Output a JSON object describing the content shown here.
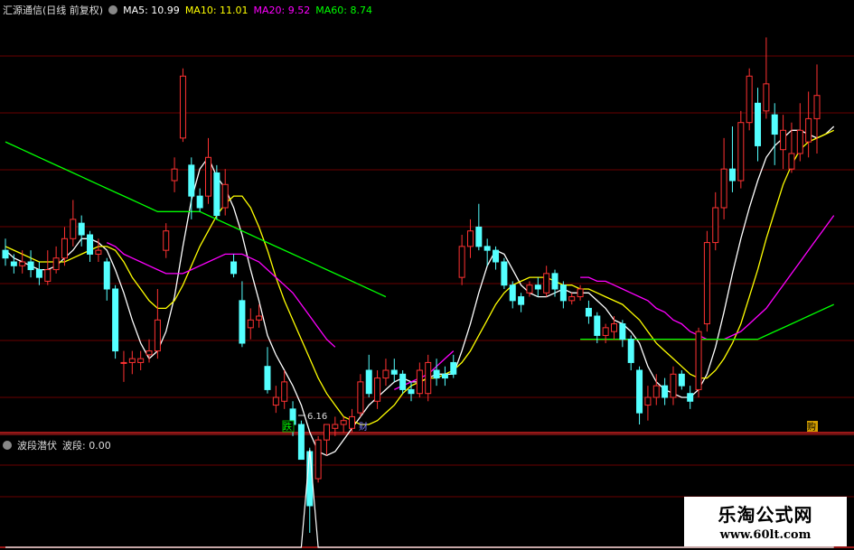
{
  "header": {
    "title": "汇源通信(日线 前复权)",
    "ma5": "MA5: 10.99",
    "ma10": "MA10: 11.01",
    "ma20": "MA20: 9.52",
    "ma60": "MA60: 8.74"
  },
  "sub_header": {
    "name": "波段潜伏",
    "value": "波段: 0.00"
  },
  "low_label": "6.16",
  "signal_labels": {
    "a": "跌",
    "b": "财",
    "c": "购"
  },
  "watermark": {
    "cn": "乐淘公式网",
    "url": "www.60lt.com"
  },
  "colors": {
    "up": "#ff3232",
    "down": "#54ffff",
    "ma5": "#ffffff",
    "ma10": "#ffff00",
    "ma20": "#ff00ff",
    "ma60": "#00ff00",
    "grid": "#8b0000",
    "bg": "#000000"
  },
  "chart_data": [
    {
      "type": "candlestick",
      "title": "汇源通信(日线 前复权)",
      "ylim": [
        5.0,
        15.5
      ],
      "candles": [
        {
          "o": 9.5,
          "c": 9.3,
          "h": 9.8,
          "l": 9.1
        },
        {
          "o": 9.2,
          "c": 9.1,
          "h": 9.4,
          "l": 8.9
        },
        {
          "o": 9.1,
          "c": 9.2,
          "h": 9.5,
          "l": 8.9
        },
        {
          "o": 9.2,
          "c": 9.0,
          "h": 9.5,
          "l": 8.8
        },
        {
          "o": 9.0,
          "c": 8.8,
          "h": 9.2,
          "l": 8.6
        },
        {
          "o": 8.7,
          "c": 9.0,
          "h": 9.5,
          "l": 8.6
        },
        {
          "o": 9.0,
          "c": 9.3,
          "h": 9.6,
          "l": 8.9
        },
        {
          "o": 9.3,
          "c": 9.8,
          "h": 10.1,
          "l": 9.1
        },
        {
          "o": 9.8,
          "c": 10.3,
          "h": 10.8,
          "l": 9.6
        },
        {
          "o": 10.2,
          "c": 9.9,
          "h": 10.4,
          "l": 9.6
        },
        {
          "o": 9.9,
          "c": 9.4,
          "h": 10.0,
          "l": 9.2
        },
        {
          "o": 9.4,
          "c": 9.5,
          "h": 9.8,
          "l": 9.2
        },
        {
          "o": 9.2,
          "c": 8.5,
          "h": 9.3,
          "l": 8.2
        },
        {
          "o": 8.5,
          "c": 6.9,
          "h": 8.6,
          "l": 6.7
        },
        {
          "o": 6.6,
          "c": 6.6,
          "h": 6.9,
          "l": 6.1
        },
        {
          "o": 6.6,
          "c": 6.7,
          "h": 6.9,
          "l": 6.3
        },
        {
          "o": 6.6,
          "c": 6.7,
          "h": 6.9,
          "l": 6.4
        },
        {
          "o": 6.8,
          "c": 6.9,
          "h": 7.2,
          "l": 6.6
        },
        {
          "o": 6.9,
          "c": 7.7,
          "h": 8.5,
          "l": 6.7
        },
        {
          "o": 9.5,
          "c": 10.0,
          "h": 10.2,
          "l": 9.3
        },
        {
          "o": 11.3,
          "c": 11.6,
          "h": 11.9,
          "l": 11.0
        },
        {
          "o": 12.4,
          "c": 14.0,
          "h": 14.2,
          "l": 12.3
        },
        {
          "o": 11.7,
          "c": 10.9,
          "h": 11.9,
          "l": 10.3
        },
        {
          "o": 10.9,
          "c": 10.6,
          "h": 11.1,
          "l": 10.5
        },
        {
          "o": 10.9,
          "c": 11.9,
          "h": 12.4,
          "l": 10.7
        },
        {
          "o": 11.5,
          "c": 10.4,
          "h": 11.7,
          "l": 10.3
        },
        {
          "o": 10.6,
          "c": 11.2,
          "h": 11.6,
          "l": 10.4
        },
        {
          "o": 9.2,
          "c": 8.9,
          "h": 9.4,
          "l": 8.8
        },
        {
          "o": 8.2,
          "c": 7.1,
          "h": 8.7,
          "l": 7.0
        },
        {
          "o": 7.5,
          "c": 7.7,
          "h": 8.0,
          "l": 7.2
        },
        {
          "o": 7.7,
          "c": 7.8,
          "h": 8.1,
          "l": 7.5
        },
        {
          "o": 6.5,
          "c": 5.9,
          "h": 7.0,
          "l": 5.8
        },
        {
          "o": 5.5,
          "c": 5.7,
          "h": 6.0,
          "l": 5.3
        },
        {
          "o": 5.6,
          "c": 6.1,
          "h": 6.4,
          "l": 5.4
        },
        {
          "o": 5.4,
          "c": 5.0,
          "h": 5.6,
          "l": 4.7
        },
        {
          "o": 5.0,
          "c": 4.1,
          "h": 5.1,
          "l": 4.1
        },
        {
          "o": 4.3,
          "c": 2.9,
          "h": 4.4,
          "l": 2.2
        },
        {
          "o": 3.6,
          "c": 4.6,
          "h": 4.7,
          "l": 3.5
        },
        {
          "o": 4.6,
          "c": 5.0,
          "h": 5.0,
          "l": 4.2
        },
        {
          "o": 4.9,
          "c": 5.0,
          "h": 5.2,
          "l": 4.7
        },
        {
          "o": 5.0,
          "c": 5.1,
          "h": 5.2,
          "l": 4.8
        },
        {
          "o": 4.9,
          "c": 5.2,
          "h": 5.4,
          "l": 4.8
        },
        {
          "o": 5.3,
          "c": 6.1,
          "h": 6.3,
          "l": 5.2
        },
        {
          "o": 6.4,
          "c": 5.8,
          "h": 6.8,
          "l": 5.7
        },
        {
          "o": 5.6,
          "c": 6.2,
          "h": 6.4,
          "l": 5.4
        },
        {
          "o": 6.2,
          "c": 6.4,
          "h": 6.7,
          "l": 6.0
        },
        {
          "o": 6.4,
          "c": 6.3,
          "h": 6.7,
          "l": 6.1
        },
        {
          "o": 6.3,
          "c": 5.9,
          "h": 6.4,
          "l": 5.8
        },
        {
          "o": 5.9,
          "c": 5.8,
          "h": 6.1,
          "l": 5.6
        },
        {
          "o": 5.8,
          "c": 6.4,
          "h": 6.6,
          "l": 5.7
        },
        {
          "o": 5.8,
          "c": 6.6,
          "h": 6.8,
          "l": 5.6
        },
        {
          "o": 6.4,
          "c": 6.2,
          "h": 6.7,
          "l": 6.0
        },
        {
          "o": 6.3,
          "c": 6.2,
          "h": 6.5,
          "l": 6.0
        },
        {
          "o": 6.6,
          "c": 6.3,
          "h": 6.8,
          "l": 6.2
        },
        {
          "o": 8.8,
          "c": 9.6,
          "h": 9.9,
          "l": 8.6
        },
        {
          "o": 9.6,
          "c": 10.0,
          "h": 10.3,
          "l": 9.3
        },
        {
          "o": 10.1,
          "c": 9.6,
          "h": 10.7,
          "l": 9.5
        },
        {
          "o": 9.6,
          "c": 9.5,
          "h": 9.8,
          "l": 9.1
        },
        {
          "o": 9.5,
          "c": 9.2,
          "h": 9.6,
          "l": 9.0
        },
        {
          "o": 9.2,
          "c": 8.6,
          "h": 9.3,
          "l": 8.5
        },
        {
          "o": 8.6,
          "c": 8.2,
          "h": 8.7,
          "l": 8.0
        },
        {
          "o": 8.3,
          "c": 8.1,
          "h": 8.4,
          "l": 7.9
        },
        {
          "o": 8.4,
          "c": 8.6,
          "h": 8.7,
          "l": 8.3
        },
        {
          "o": 8.6,
          "c": 8.5,
          "h": 8.8,
          "l": 8.3
        },
        {
          "o": 8.4,
          "c": 8.9,
          "h": 9.1,
          "l": 8.3
        },
        {
          "o": 8.9,
          "c": 8.5,
          "h": 9.0,
          "l": 8.3
        },
        {
          "o": 8.6,
          "c": 8.2,
          "h": 8.7,
          "l": 8.0
        },
        {
          "o": 8.2,
          "c": 8.3,
          "h": 8.4,
          "l": 8.1
        },
        {
          "o": 8.3,
          "c": 8.5,
          "h": 8.6,
          "l": 8.2
        },
        {
          "o": 8.0,
          "c": 7.8,
          "h": 8.2,
          "l": 7.6
        },
        {
          "o": 7.8,
          "c": 7.3,
          "h": 7.9,
          "l": 7.1
        },
        {
          "o": 7.3,
          "c": 7.5,
          "h": 7.6,
          "l": 7.1
        },
        {
          "o": 7.4,
          "c": 7.6,
          "h": 7.8,
          "l": 7.2
        },
        {
          "o": 7.6,
          "c": 7.2,
          "h": 7.7,
          "l": 7.0
        },
        {
          "o": 7.2,
          "c": 6.6,
          "h": 7.3,
          "l": 6.4
        },
        {
          "o": 6.4,
          "c": 5.3,
          "h": 6.5,
          "l": 5.0
        },
        {
          "o": 5.5,
          "c": 5.7,
          "h": 6.0,
          "l": 5.1
        },
        {
          "o": 5.7,
          "c": 6.0,
          "h": 6.3,
          "l": 5.5
        },
        {
          "o": 6.0,
          "c": 5.7,
          "h": 6.2,
          "l": 5.5
        },
        {
          "o": 5.7,
          "c": 6.3,
          "h": 6.5,
          "l": 5.5
        },
        {
          "o": 6.3,
          "c": 6.0,
          "h": 6.4,
          "l": 5.9
        },
        {
          "o": 5.8,
          "c": 5.6,
          "h": 6.0,
          "l": 5.4
        },
        {
          "o": 5.9,
          "c": 7.4,
          "h": 7.5,
          "l": 5.7
        },
        {
          "o": 7.6,
          "c": 9.7,
          "h": 10.0,
          "l": 7.4
        },
        {
          "o": 9.7,
          "c": 10.6,
          "h": 11.0,
          "l": 9.5
        },
        {
          "o": 10.6,
          "c": 11.6,
          "h": 12.4,
          "l": 10.3
        },
        {
          "o": 11.6,
          "c": 11.3,
          "h": 12.7,
          "l": 11.0
        },
        {
          "o": 11.3,
          "c": 12.8,
          "h": 13.1,
          "l": 11.1
        },
        {
          "o": 12.8,
          "c": 14.0,
          "h": 14.2,
          "l": 12.6
        },
        {
          "o": 13.3,
          "c": 12.2,
          "h": 13.7,
          "l": 11.8
        },
        {
          "o": 13.1,
          "c": 13.8,
          "h": 15.0,
          "l": 12.9
        },
        {
          "o": 13.0,
          "c": 12.5,
          "h": 13.3,
          "l": 11.7
        },
        {
          "o": 12.1,
          "c": 12.6,
          "h": 13.0,
          "l": 11.6
        },
        {
          "o": 11.6,
          "c": 12.0,
          "h": 12.8,
          "l": 11.5
        },
        {
          "o": 12.0,
          "c": 12.6,
          "h": 13.3,
          "l": 11.8
        },
        {
          "o": 12.3,
          "c": 12.9,
          "h": 13.6,
          "l": 11.9
        },
        {
          "o": 12.9,
          "c": 13.5,
          "h": 14.3,
          "l": 12.0
        }
      ],
      "ma": [
        {
          "name": "MA5",
          "values": [
            9.5,
            9.3,
            9.2,
            9.1,
            9.0,
            9.0,
            9.1,
            9.3,
            9.5,
            9.8,
            9.8,
            9.7,
            9.5,
            9.0,
            8.4,
            7.7,
            7.1,
            6.7,
            6.9,
            7.4,
            8.3,
            9.6,
            10.8,
            11.6,
            11.9,
            11.4,
            11.1,
            10.6,
            9.9,
            9.0,
            8.2,
            7.3,
            6.8,
            6.4,
            6.0,
            5.5,
            4.8,
            4.3,
            4.2,
            4.3,
            4.6,
            4.9,
            5.2,
            5.5,
            5.7,
            5.9,
            6.1,
            6.2,
            6.1,
            6.1,
            6.2,
            6.3,
            6.3,
            6.3,
            6.9,
            7.6,
            8.4,
            9.1,
            9.5,
            9.4,
            9.0,
            8.6,
            8.4,
            8.3,
            8.3,
            8.4,
            8.5,
            8.4,
            8.4,
            8.4,
            8.2,
            8.0,
            7.7,
            7.6,
            7.4,
            7.1,
            6.5,
            6.1,
            5.9,
            5.8,
            5.7,
            5.7,
            5.9,
            6.3,
            7.0,
            7.9,
            8.9,
            9.8,
            10.6,
            11.3,
            11.9,
            12.2,
            12.4,
            12.6,
            12.6,
            12.5,
            12.4,
            12.5,
            12.7
          ]
        },
        {
          "name": "MA10",
          "values": [
            9.6,
            9.5,
            9.4,
            9.3,
            9.2,
            9.2,
            9.2,
            9.2,
            9.3,
            9.4,
            9.5,
            9.6,
            9.6,
            9.5,
            9.2,
            8.8,
            8.5,
            8.2,
            8.0,
            8.0,
            8.2,
            8.6,
            9.1,
            9.6,
            10.0,
            10.4,
            10.7,
            10.9,
            10.9,
            10.6,
            10.1,
            9.5,
            8.8,
            8.2,
            7.7,
            7.2,
            6.7,
            6.2,
            5.8,
            5.5,
            5.2,
            5.1,
            5.0,
            5.0,
            5.1,
            5.3,
            5.5,
            5.8,
            6.0,
            6.1,
            6.2,
            6.2,
            6.3,
            6.4,
            6.6,
            6.9,
            7.3,
            7.7,
            8.1,
            8.4,
            8.6,
            8.7,
            8.8,
            8.8,
            8.8,
            8.7,
            8.6,
            8.6,
            8.5,
            8.5,
            8.4,
            8.3,
            8.2,
            8.1,
            7.9,
            7.7,
            7.4,
            7.1,
            6.9,
            6.7,
            6.5,
            6.3,
            6.2,
            6.2,
            6.4,
            6.7,
            7.1,
            7.6,
            8.3,
            9.0,
            9.8,
            10.5,
            11.2,
            11.7,
            12.1,
            12.3,
            12.4,
            12.5,
            12.6
          ]
        },
        {
          "name": "MA20",
          "values": [
            null,
            null,
            null,
            null,
            null,
            null,
            null,
            null,
            null,
            null,
            null,
            null,
            9.7,
            9.6,
            9.4,
            9.3,
            9.2,
            9.1,
            9.0,
            8.9,
            8.9,
            8.9,
            9.0,
            9.1,
            9.2,
            9.3,
            9.4,
            9.4,
            9.4,
            9.3,
            9.2,
            9.0,
            8.8,
            8.6,
            8.4,
            8.1,
            7.8,
            7.5,
            7.2,
            7.0,
            null,
            null,
            null,
            null,
            null,
            null,
            5.9,
            6.0,
            6.1,
            6.2,
            6.3,
            6.5,
            6.7,
            6.9,
            null,
            null,
            null,
            null,
            null,
            null,
            null,
            null,
            null,
            null,
            null,
            null,
            null,
            null,
            8.8,
            8.8,
            8.7,
            8.7,
            8.6,
            8.5,
            8.4,
            8.3,
            8.2,
            8.0,
            7.9,
            7.7,
            7.6,
            7.4,
            7.3,
            7.2,
            7.2,
            7.2,
            7.3,
            7.4,
            7.6,
            7.8,
            8.0,
            8.3,
            8.6,
            8.9,
            9.2,
            9.5,
            9.8,
            10.1,
            10.4
          ]
        },
        {
          "name": "MA60",
          "values": [
            12.3,
            12.2,
            12.1,
            12.0,
            11.9,
            11.8,
            11.7,
            11.6,
            11.5,
            11.4,
            11.3,
            11.2,
            11.1,
            11.0,
            10.9,
            10.8,
            10.7,
            10.6,
            10.5,
            10.5,
            10.5,
            10.5,
            10.5,
            10.5,
            10.4,
            10.3,
            10.2,
            10.1,
            10.0,
            9.9,
            9.8,
            9.7,
            9.6,
            9.5,
            9.4,
            9.3,
            9.2,
            9.1,
            9.0,
            8.9,
            8.8,
            8.7,
            8.6,
            8.5,
            8.4,
            8.3,
            null,
            null,
            null,
            null,
            null,
            null,
            null,
            null,
            null,
            null,
            null,
            null,
            null,
            null,
            null,
            null,
            null,
            null,
            null,
            null,
            null,
            null,
            7.2,
            7.2,
            7.2,
            7.2,
            7.2,
            7.2,
            7.2,
            7.2,
            7.2,
            7.2,
            7.2,
            7.2,
            7.2,
            7.2,
            7.2,
            7.2,
            7.2,
            7.2,
            7.2,
            7.2,
            7.2,
            7.2,
            7.3,
            7.4,
            7.5,
            7.6,
            7.7,
            7.8,
            7.9,
            8.0,
            8.1
          ]
        }
      ],
      "annotations": [
        {
          "type": "low",
          "value": 6.16
        }
      ]
    },
    {
      "type": "line",
      "title": "波段潜伏",
      "ylim": [
        0,
        1
      ],
      "series": [
        {
          "name": "波段",
          "values": [
            0,
            0,
            0,
            0,
            0,
            0,
            0,
            0,
            0,
            0,
            0,
            0,
            0,
            0,
            0,
            0,
            0,
            0,
            0,
            0,
            0,
            0,
            0,
            0,
            0,
            0,
            0,
            0,
            0,
            0,
            0,
            0,
            0,
            0,
            0,
            0,
            1,
            0,
            0,
            0,
            0,
            0,
            0,
            0,
            0,
            0,
            0,
            0,
            0,
            0,
            0,
            0,
            0,
            0,
            0,
            0,
            0,
            0,
            0,
            0,
            0,
            0,
            0,
            0,
            0,
            0,
            0,
            0,
            0,
            0,
            0,
            0,
            0,
            0,
            0,
            0,
            0,
            0,
            0,
            0,
            0,
            0,
            0,
            0,
            0,
            0,
            0,
            0,
            0,
            0,
            0,
            0,
            0,
            0,
            0,
            0,
            0,
            0,
            0
          ]
        }
      ]
    }
  ]
}
